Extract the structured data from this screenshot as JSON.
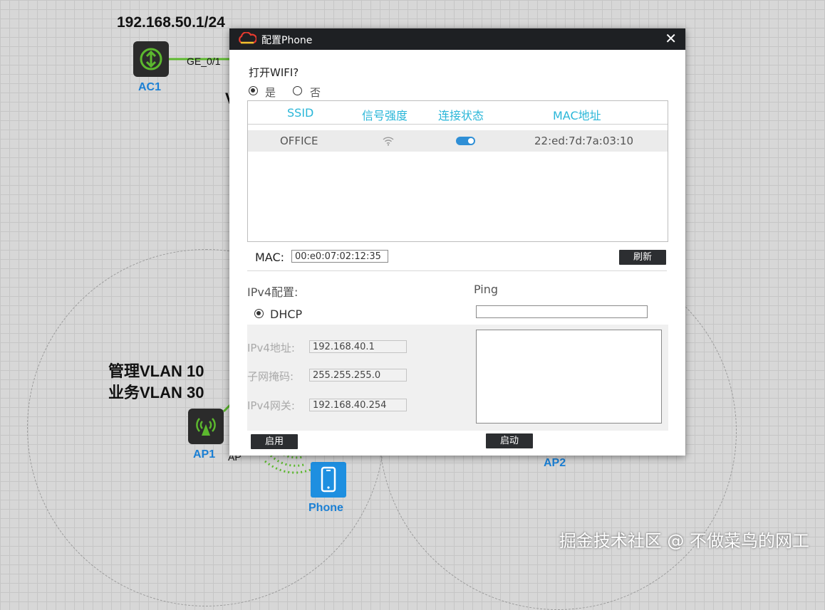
{
  "canvas": {
    "ip_label": "192.168.50.1/24",
    "port_ge": "GE_0/1",
    "port_ap": "AP",
    "partial_text": "V",
    "vlan_mgmt": "管理VLAN 10",
    "vlan_service": "业务VLAN 30",
    "devices": {
      "ac1": "AC1",
      "ap1": "AP1",
      "ap2": "AP2",
      "phone": "Phone"
    },
    "watermark": "掘金技术社区 @ 不做菜鸟的网工",
    "colors": {
      "device_label": "#1a7fd4",
      "link_green": "#5cb82e",
      "phone_tile": "#1e8fe0"
    }
  },
  "dialog": {
    "title": "配置Phone",
    "close_symbol": "✕",
    "wifi_question": "打开WIFI?",
    "wifi_options": {
      "yes": "是",
      "no": "否",
      "selected": "yes"
    },
    "table": {
      "headers": [
        "SSID",
        "信号强度",
        "连接状态",
        "MAC地址"
      ],
      "rows": [
        {
          "ssid": "OFFICE",
          "signal_icon": "wifi-signal-icon",
          "connected": true,
          "mac": "22:ed:7d:7a:03:10"
        }
      ]
    },
    "mac_label": "MAC:",
    "mac_value": "00:e0:07:02:12:35",
    "refresh_button": "刷新",
    "ipv4_title": "IPv4配置:",
    "dhcp_label": "DHCP",
    "dhcp_selected": true,
    "ipv4_address_label": "IPv4地址:",
    "ipv4_address": "192.168.40.1",
    "subnet_label": "子网掩码:",
    "subnet": "255.255.255.0",
    "gateway_label": "IPv4网关:",
    "gateway": "192.168.40.254",
    "apply_button": "启用",
    "ping_title": "Ping",
    "ping_target": "",
    "ping_button": "启动",
    "colors": {
      "header_text": "#29b6d8",
      "toggle_on": "#2f8fd6",
      "titlebar": "#1e2023"
    }
  }
}
